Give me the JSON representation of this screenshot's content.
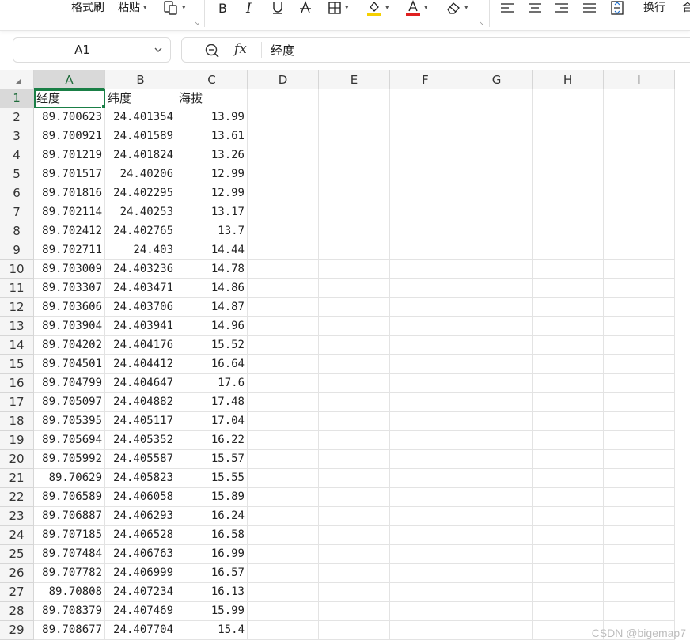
{
  "ribbon": {
    "format_painter": "格式刷",
    "paste": "粘贴",
    "wrap_text": "换行",
    "merge_partial": "合"
  },
  "icons": {
    "copy": "copy-icon",
    "bold": "bold-icon",
    "italic": "italic-icon",
    "underline": "underline-icon",
    "strikethrough": "strikethrough-icon",
    "borders": "borders-icon",
    "fill_color": "fill-color-icon",
    "font_color": "font-color-icon",
    "clear": "eraser-icon",
    "align_left": "align-left-icon",
    "align_center": "align-center-icon",
    "align_right": "align-right-icon",
    "justify": "justify-icon",
    "distributed": "distributed-align-icon",
    "zoom": "zoom-icon",
    "fx": "function-icon"
  },
  "colors": {
    "selection": "#1a7f46",
    "fill_swatch": "#f5d000",
    "font_swatch": "#e02020"
  },
  "formula_bar": {
    "cell_ref": "A1",
    "fx_label": "fx",
    "content": "经度"
  },
  "columns": [
    "A",
    "B",
    "C",
    "D",
    "E",
    "F",
    "G",
    "H",
    "I"
  ],
  "rows": [
    {
      "n": "1",
      "cells": [
        "经度",
        "纬度",
        "海拔"
      ]
    },
    {
      "n": "2",
      "cells": [
        "89.700623",
        "24.401354",
        "13.99"
      ]
    },
    {
      "n": "3",
      "cells": [
        "89.700921",
        "24.401589",
        "13.61"
      ]
    },
    {
      "n": "4",
      "cells": [
        "89.701219",
        "24.401824",
        "13.26"
      ]
    },
    {
      "n": "5",
      "cells": [
        "89.701517",
        "24.40206",
        "12.99"
      ]
    },
    {
      "n": "6",
      "cells": [
        "89.701816",
        "24.402295",
        "12.99"
      ]
    },
    {
      "n": "7",
      "cells": [
        "89.702114",
        "24.40253",
        "13.17"
      ]
    },
    {
      "n": "8",
      "cells": [
        "89.702412",
        "24.402765",
        "13.7"
      ]
    },
    {
      "n": "9",
      "cells": [
        "89.702711",
        "24.403",
        "14.44"
      ]
    },
    {
      "n": "10",
      "cells": [
        "89.703009",
        "24.403236",
        "14.78"
      ]
    },
    {
      "n": "11",
      "cells": [
        "89.703307",
        "24.403471",
        "14.86"
      ]
    },
    {
      "n": "12",
      "cells": [
        "89.703606",
        "24.403706",
        "14.87"
      ]
    },
    {
      "n": "13",
      "cells": [
        "89.703904",
        "24.403941",
        "14.96"
      ]
    },
    {
      "n": "14",
      "cells": [
        "89.704202",
        "24.404176",
        "15.52"
      ]
    },
    {
      "n": "15",
      "cells": [
        "89.704501",
        "24.404412",
        "16.64"
      ]
    },
    {
      "n": "16",
      "cells": [
        "89.704799",
        "24.404647",
        "17.6"
      ]
    },
    {
      "n": "17",
      "cells": [
        "89.705097",
        "24.404882",
        "17.48"
      ]
    },
    {
      "n": "18",
      "cells": [
        "89.705395",
        "24.405117",
        "17.04"
      ]
    },
    {
      "n": "19",
      "cells": [
        "89.705694",
        "24.405352",
        "16.22"
      ]
    },
    {
      "n": "20",
      "cells": [
        "89.705992",
        "24.405587",
        "15.57"
      ]
    },
    {
      "n": "21",
      "cells": [
        "89.70629",
        "24.405823",
        "15.55"
      ]
    },
    {
      "n": "22",
      "cells": [
        "89.706589",
        "24.406058",
        "15.89"
      ]
    },
    {
      "n": "23",
      "cells": [
        "89.706887",
        "24.406293",
        "16.24"
      ]
    },
    {
      "n": "24",
      "cells": [
        "89.707185",
        "24.406528",
        "16.58"
      ]
    },
    {
      "n": "25",
      "cells": [
        "89.707484",
        "24.406763",
        "16.99"
      ]
    },
    {
      "n": "26",
      "cells": [
        "89.707782",
        "24.406999",
        "16.57"
      ]
    },
    {
      "n": "27",
      "cells": [
        "89.70808",
        "24.407234",
        "16.13"
      ]
    },
    {
      "n": "28",
      "cells": [
        "89.708379",
        "24.407469",
        "15.99"
      ]
    },
    {
      "n": "29",
      "cells": [
        "89.708677",
        "24.407704",
        "15.4"
      ]
    }
  ],
  "watermark": "CSDN @bigemap7"
}
